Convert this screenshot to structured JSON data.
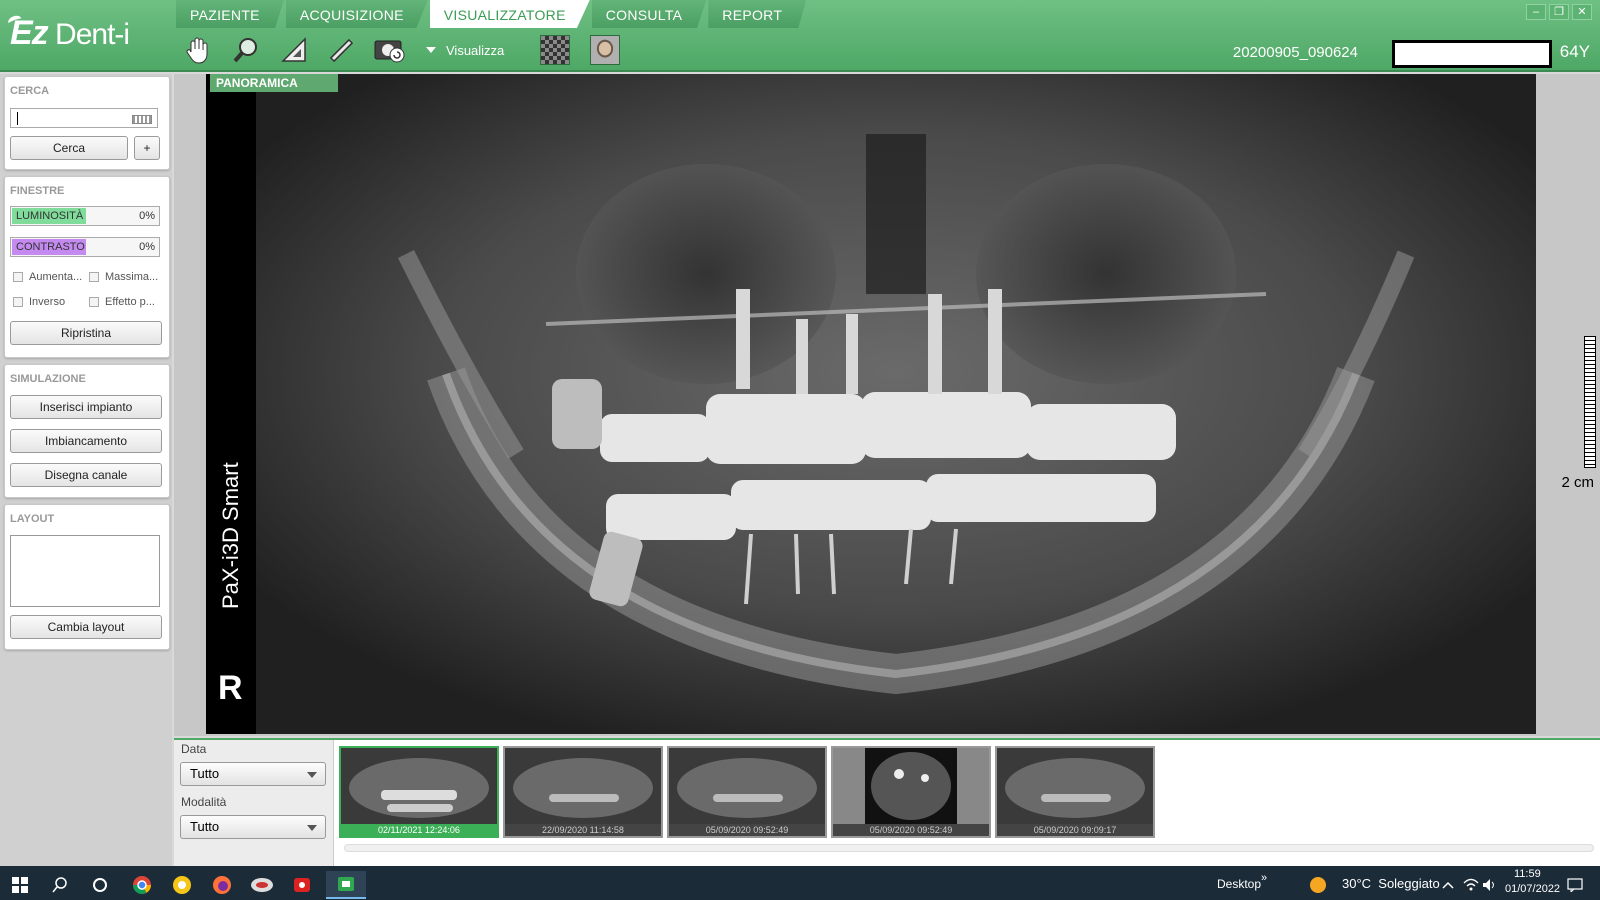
{
  "app": {
    "logo_ez": "Ez",
    "logo_dent": "Dent-i",
    "tabs": [
      "PAZIENTE",
      "ACQUISIZIONE",
      "VISUALIZZATORE",
      "CONSULTA",
      "REPORT"
    ],
    "active_tab": 2,
    "toolbar": {
      "icons": [
        "pan-hand-icon",
        "magnifier-icon",
        "measure-icon",
        "pencil-icon",
        "capture-icon"
      ],
      "view_label": "Visualizza"
    },
    "patient_id": "20200905_090624",
    "patient_age": "64Y"
  },
  "left_panel": {
    "search": {
      "title": "CERCA",
      "search_button": "Cerca",
      "add_button": "+"
    },
    "windows": {
      "title": "FINESTRE",
      "brightness_label": "LUMINOSITÀ",
      "brightness_value": "0%",
      "contrast_label": "CONTRASTO",
      "contrast_value": "0%",
      "options": [
        "Aumenta...",
        "Massima...",
        "Inverso",
        "Effetto p..."
      ],
      "reset_button": "Ripristina"
    },
    "simulation": {
      "title": "SIMULAZIONE",
      "buttons": [
        "Inserisci impianto",
        "Imbiancamento",
        "Disegna canale"
      ]
    },
    "layout": {
      "title": "LAYOUT",
      "change_button": "Cambia layout"
    }
  },
  "viewer": {
    "image_label": "PANORAMICA",
    "device": "PaX-i3D Smart",
    "side_marker": "R",
    "ruler_label": "2 cm"
  },
  "bottom": {
    "date_label": "Data",
    "date_value": "Tutto",
    "modality_label": "Modalità",
    "modality_value": "Tutto",
    "thumbnails": [
      "02/11/2021 12:24:06",
      "22/09/2020 11:14:58",
      "05/09/2020 09:52:49",
      "05/09/2020 09:52:49",
      "05/09/2020 09:09:17"
    ]
  },
  "taskbar": {
    "desktop_label": "Desktop",
    "chevron": "»",
    "weather": "30°C  Soleggiato",
    "time": "11:59",
    "date": "01/07/2022"
  },
  "colors": {
    "accent": "#4ea866",
    "brightness_fill": "#7fdc9a",
    "contrast_fill": "#c58af0"
  }
}
